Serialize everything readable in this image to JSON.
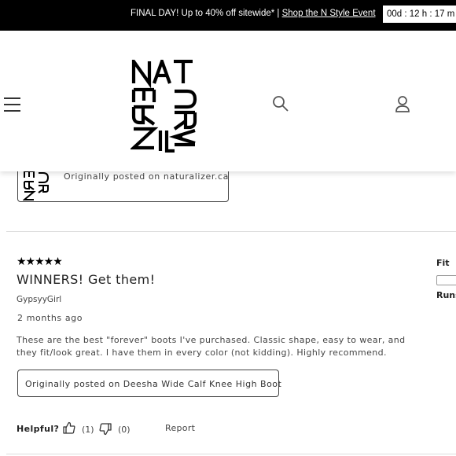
{
  "promo": {
    "text": "FINAL DAY! Up to 40% off sitewide* | ",
    "link": "Shop the N Style Event",
    "countdown": "00d : 12 h : 17 m"
  },
  "header": {
    "logo_alt": "NATURALIZER",
    "icons": [
      "hamburger-icon",
      "search-icon",
      "account-icon"
    ]
  },
  "previous_review": {
    "origin": "Originally posted on naturalizer.ca"
  },
  "review": {
    "rating": 5,
    "stars": "★★★★★",
    "title": "WINNERS! Get them!",
    "author": "GypsyyGirl",
    "date": "2 months ago",
    "body": "These are the best \"forever\" boots I've purchased. Classic shape, easy to wear, and they fit/look great. I have them in every color (not kidding). Highly recommend.",
    "origin": "Originally posted on Deesha Wide Calf Knee High Boot",
    "helpful_label": "Helpful?",
    "helpful_yes": "(1)",
    "helpful_no": "(0)",
    "report": "Report"
  },
  "fit": {
    "label": "Fit",
    "runs_label": "Runs"
  },
  "colors": {
    "promo_bg": "#000000",
    "text": "#222222",
    "border": "#444444"
  }
}
